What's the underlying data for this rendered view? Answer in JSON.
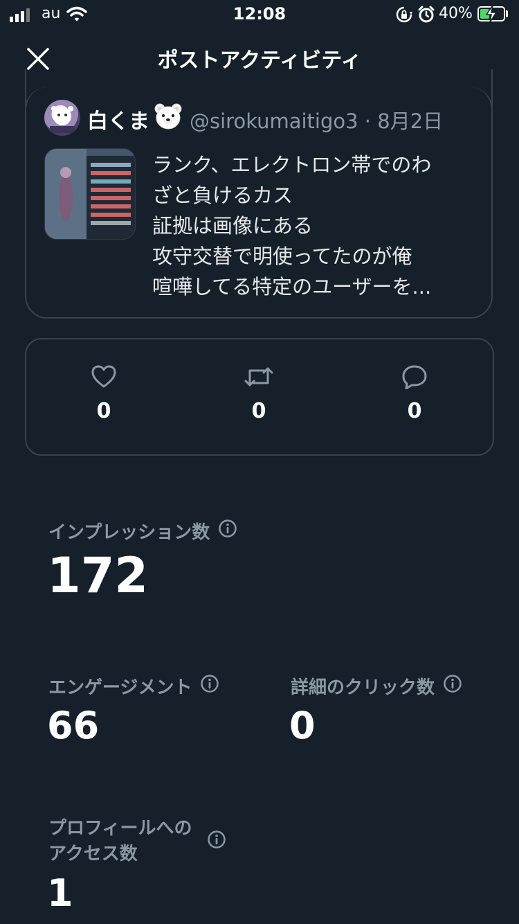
{
  "status_bar": {
    "carrier": "au",
    "time": "12:08",
    "battery": "40%",
    "battery_level": 0.4
  },
  "header": {
    "title": "ポストアクティビティ"
  },
  "post": {
    "author_name": "白くま",
    "author_handle_date": "@sirokumaitigo3 · 8月2日",
    "text_lines": [
      "ランク、エレクトロン帯でのわ",
      "ざと負けるカス",
      "証拠は画像にある",
      "攻守交替で明使ってたのが俺",
      "喧嘩してる特定のユーザーを..."
    ]
  },
  "engagement": {
    "likes": "0",
    "reposts": "0",
    "replies": "0"
  },
  "metrics": {
    "impressions_label": "インプレッション数",
    "impressions_value": "172",
    "engagements_label": "エンゲージメント",
    "engagements_value": "66",
    "detail_clicks_label": "詳細のクリック数",
    "detail_clicks_value": "0",
    "profile_visits_label_line1": "プロフィールへの",
    "profile_visits_label_line2": "アクセス数",
    "profile_visits_value": "1"
  },
  "colors": {
    "background": "#15202b",
    "border": "#38444d",
    "secondary_text": "#8b98a5"
  }
}
